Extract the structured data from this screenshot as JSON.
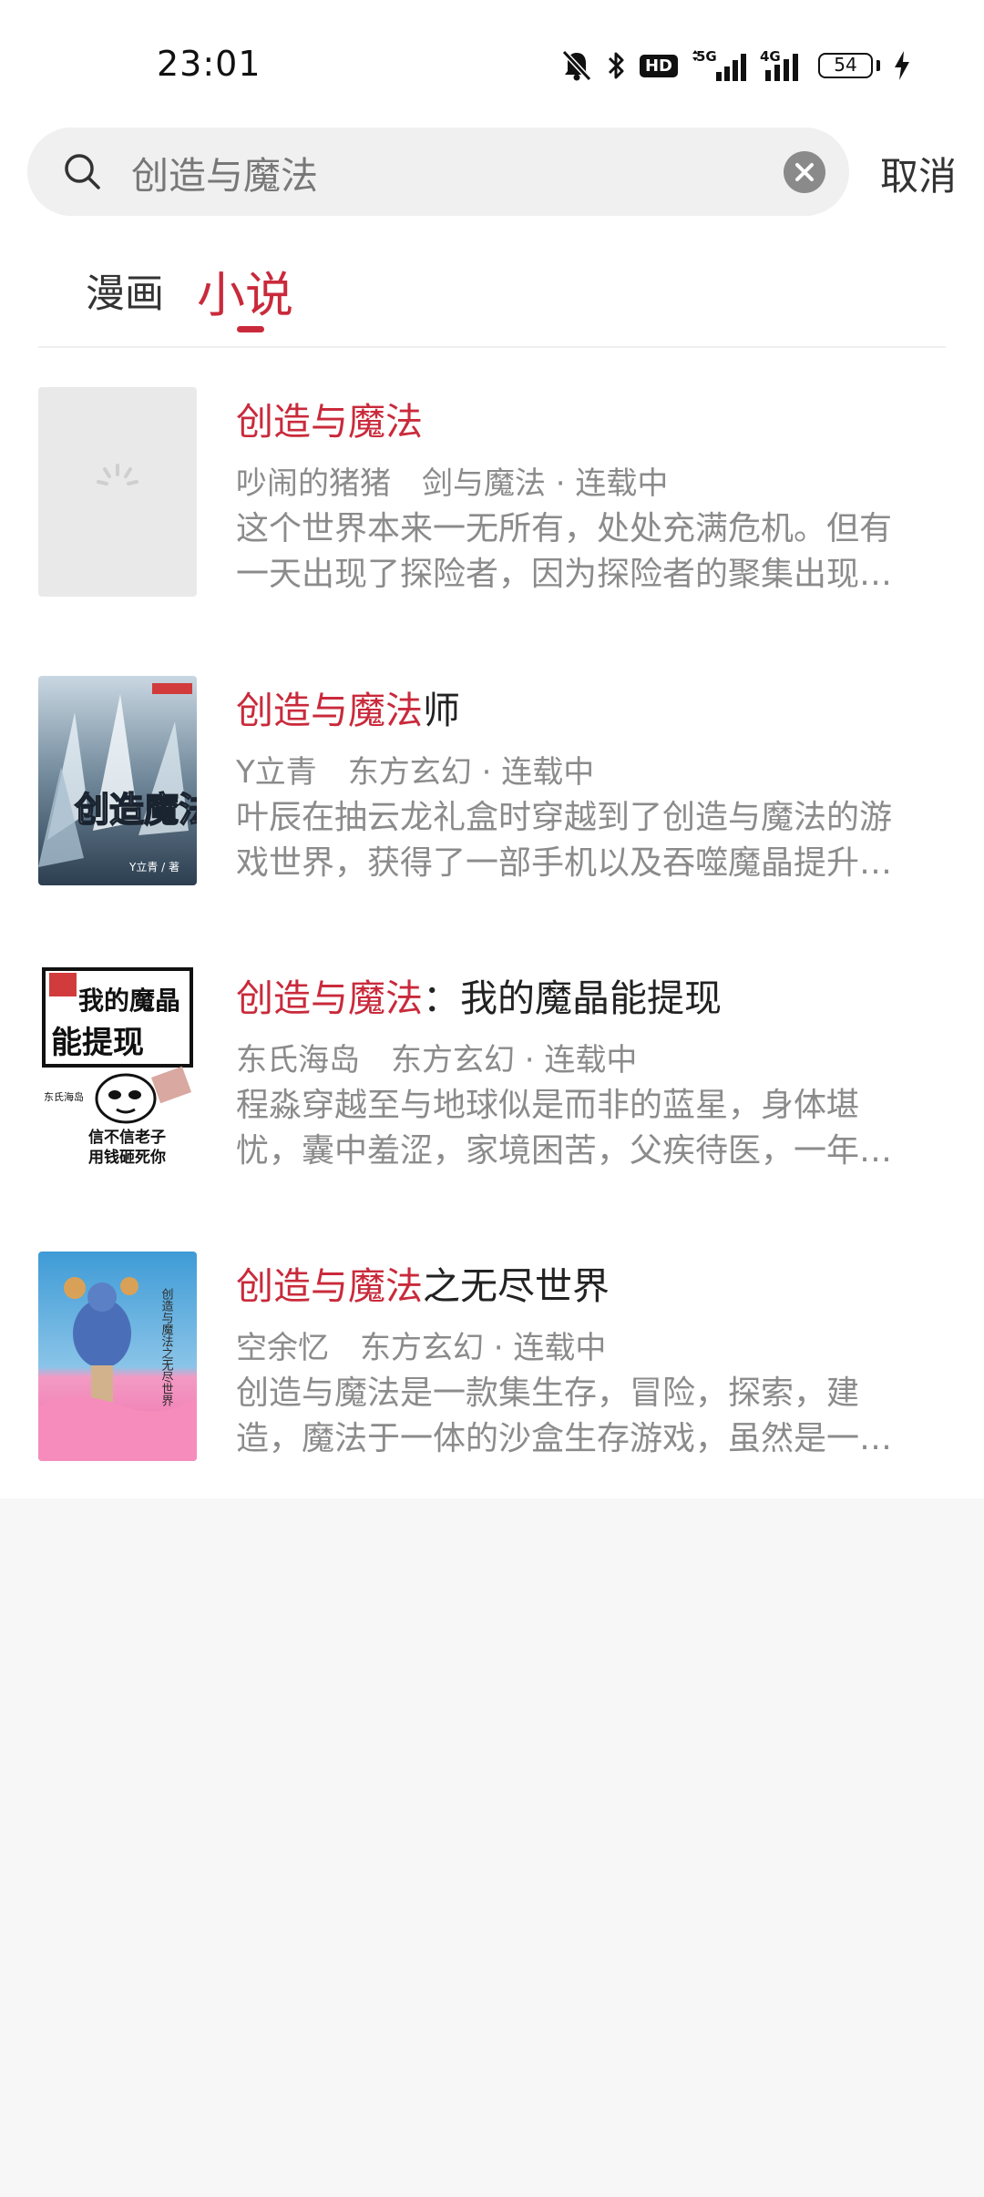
{
  "status_bar": {
    "time": "23:01",
    "hd": "HD",
    "net1": "5G",
    "net2": "4G",
    "battery": "54",
    "icons": [
      "mute-icon",
      "bluetooth-icon",
      "hd-icon",
      "signal-5g-icon",
      "signal-4g-icon",
      "battery-icon",
      "charging-icon"
    ]
  },
  "search": {
    "query": "创造与魔法",
    "cancel_label": "取消"
  },
  "tabs": [
    {
      "label": "漫画",
      "active": false
    },
    {
      "label": "小说",
      "active": true
    }
  ],
  "accent_color": "#c92a3b",
  "results": [
    {
      "title_highlight": "创造与魔法",
      "title_rest": "",
      "author": "吵闹的猪猪",
      "category": "剑与魔法 · 连载中",
      "description": "这个世界本来一无所有，处处充满危机。但有一天出现了探险者，因为探险者的聚集出现…",
      "cover": "loading-placeholder"
    },
    {
      "title_highlight": "创造与魔法",
      "title_rest": "师",
      "author": "Y立青",
      "category": "东方玄幻 · 连载中",
      "description": "叶辰在抽云龙礼盒时穿越到了创造与魔法的游戏世界，获得了一部手机以及吞噬魔晶提升…",
      "cover": "ice-mage-cover",
      "cover_text": "创造魔法师",
      "cover_author": "Y立青 / 著"
    },
    {
      "title_highlight": "创造与魔法",
      "title_rest": "：我的魔晶能提现",
      "author": "东氏海岛",
      "category": "东方玄幻 · 连载中",
      "description": "程淼穿越至与地球似是而非的蓝星，身体堪忧，囊中羞涩，家境困苦，父疾待医，一年…",
      "cover": "meme-cover",
      "cover_text_1": "我的魔晶",
      "cover_text_2": "能提现",
      "cover_text_3": "信不信老子",
      "cover_text_4": "用钱砸死你",
      "cover_side": "东氏海岛"
    },
    {
      "title_highlight": "创造与魔法",
      "title_rest": "之无尽世界",
      "author": "空余忆",
      "category": "东方玄幻 · 连载中",
      "description": "创造与魔法是一款集生存，冒险，探索，建造，魔法于一体的沙盒生存游戏，虽然是一…",
      "cover": "pink-field-cover",
      "cover_text": "创造与魔法之无尽世界"
    }
  ]
}
